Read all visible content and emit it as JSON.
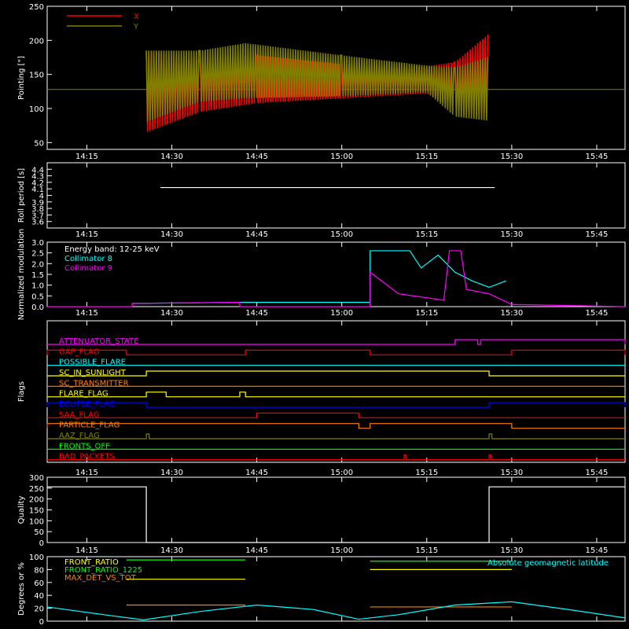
{
  "time_ticks": [
    "14:15",
    "14:30",
    "14:45",
    "15:00",
    "15:15",
    "15:30",
    "15:45"
  ],
  "chart_data": [
    {
      "type": "line",
      "panel": "pointing",
      "ylabel": "Pointing [\"]",
      "ylim": [
        40,
        250
      ],
      "yticks": [
        50,
        100,
        150,
        200,
        250
      ],
      "x_range": [
        "14:08",
        "15:50"
      ],
      "legend": {
        "placement": "top-left"
      },
      "baseline": 128,
      "series": [
        {
          "name": "X",
          "color": "#ff0000",
          "envelope": [
            {
              "t": "14:25.5",
              "min": 65,
              "max": 185
            },
            {
              "t": "14:35",
              "min": 95,
              "max": 172
            },
            {
              "t": "14:45",
              "min": 108,
              "max": 178
            },
            {
              "t": "15:00",
              "min": 115,
              "max": 165
            },
            {
              "t": "15:15",
              "min": 122,
              "max": 162
            },
            {
              "t": "15:20",
              "min": 100,
              "max": 168
            },
            {
              "t": "15:26",
              "min": 88,
              "max": 210
            }
          ]
        },
        {
          "name": "Y",
          "color": "#808000",
          "envelope": [
            {
              "t": "14:25.5",
              "min": 80,
              "max": 185
            },
            {
              "t": "14:35",
              "min": 110,
              "max": 185
            },
            {
              "t": "14:43",
              "min": 115,
              "max": 196
            },
            {
              "t": "15:00",
              "min": 118,
              "max": 178
            },
            {
              "t": "15:15",
              "min": 124,
              "max": 163
            },
            {
              "t": "15:20",
              "min": 88,
              "max": 160
            },
            {
              "t": "15:26",
              "min": 82,
              "max": 176
            }
          ]
        }
      ]
    },
    {
      "type": "line",
      "panel": "roll",
      "ylabel": "Roll period [s]",
      "ylim": [
        3.5,
        4.5
      ],
      "yticks": [
        3.6,
        3.7,
        3.8,
        3.9,
        4.0,
        4.1,
        4.2,
        4.3,
        4.4
      ],
      "series": [
        {
          "name": "",
          "color": "#ffffff",
          "segments": [
            [
              "14:28",
              "15:27",
              4.12
            ]
          ]
        }
      ]
    },
    {
      "type": "line",
      "panel": "modulation",
      "ylabel": "Normalized modulation",
      "ylim": [
        0,
        3.0
      ],
      "yticks": [
        "0.0",
        "0.5",
        "1.0",
        "1.5",
        "2.0",
        "2.5",
        "3.0"
      ],
      "annotation": "Energy band: 12-25 keV",
      "legend": {
        "placement": "top-left"
      },
      "series": [
        {
          "name": "Collimator 8",
          "color": "#00ffff",
          "points": [
            [
              "14:23",
              0.15
            ],
            [
              "14:42",
              0.2
            ],
            [
              "15:05",
              0.2
            ],
            [
              "15:05",
              2.6
            ],
            [
              "15:12",
              2.6
            ],
            [
              "15:14",
              1.8
            ],
            [
              "15:17",
              2.4
            ],
            [
              "15:20",
              1.6
            ],
            [
              "15:23",
              1.2
            ],
            [
              "15:26",
              0.9
            ],
            [
              "15:29",
              1.2
            ]
          ]
        },
        {
          "name": "Collimator 9",
          "color": "#ff00ff",
          "points": [
            [
              "14:08",
              0.0
            ],
            [
              "14:23",
              0.0
            ],
            [
              "14:23",
              0.15
            ],
            [
              "14:42",
              0.2
            ],
            [
              "14:42",
              0.0
            ],
            [
              "15:05",
              0.0
            ],
            [
              "15:05",
              1.6
            ],
            [
              "15:10",
              0.6
            ],
            [
              "15:18",
              0.3
            ],
            [
              "15:19",
              2.6
            ],
            [
              "15:21",
              2.6
            ],
            [
              "15:22",
              0.8
            ],
            [
              "15:26",
              0.6
            ],
            [
              "15:30",
              0.1
            ],
            [
              "15:50",
              0.0
            ]
          ]
        }
      ]
    },
    {
      "type": "line",
      "panel": "flags",
      "ylabel": "Flags",
      "rows": [
        {
          "name": "ATTENUATOR_STATE",
          "color": "#ff00ff",
          "highs": [
            [
              "15:20",
              "15:24"
            ],
            [
              "15:24.5",
              "15:50"
            ]
          ]
        },
        {
          "name": "GAP_FLAG",
          "color": "#ff0000",
          "highs": [
            [
              "14:08",
              "14:22"
            ],
            [
              "14:43",
              "15:05"
            ],
            [
              "15:30",
              "15:50"
            ]
          ]
        },
        {
          "name": "POSSIBLE_FLARE",
          "color": "#00ffff",
          "highs": []
        },
        {
          "name": "SC_IN_SUNLIGHT",
          "color": "#ffff00",
          "highs": [
            [
              "14:25.5",
              "15:26"
            ]
          ]
        },
        {
          "name": "SC_TRANSMITTER",
          "color": "#ff7f00",
          "highs": []
        },
        {
          "name": "FLARE_FLAG",
          "color": "#ffff00",
          "highs": [
            [
              "14:25.5",
              "14:29"
            ],
            [
              "14:42",
              "14:43"
            ]
          ]
        },
        {
          "name": "ECLIPSE_FLAG",
          "color": "#0000ff",
          "highs": [
            [
              "14:08",
              "14:25.5"
            ],
            [
              "15:26",
              "15:50"
            ]
          ]
        },
        {
          "name": "SAA_FLAG",
          "color": "#ff0000",
          "highs": [
            [
              "14:45",
              "15:03"
            ]
          ]
        },
        {
          "name": "PARTICLE_FLAG",
          "color": "#ff7f00",
          "highs": [
            [
              "14:08",
              "15:03"
            ],
            [
              "15:05",
              "15:30"
            ]
          ]
        },
        {
          "name": "AAZ_FLAG",
          "color": "#808000",
          "highs": [
            [
              "14:25.5",
              "14:26"
            ],
            [
              "15:26",
              "15:26.5"
            ]
          ]
        },
        {
          "name": "FRONTS_OFF",
          "color": "#00ff00",
          "highs": []
        },
        {
          "name": "BAD_PACKETS",
          "color": "#ff0000",
          "highs": [
            [
              "15:11",
              "15:11.3"
            ],
            [
              "15:26",
              "15:26.3"
            ]
          ]
        }
      ]
    },
    {
      "type": "line",
      "panel": "quality",
      "ylabel": "Quality",
      "ylim": [
        0,
        300
      ],
      "yticks": [
        0,
        50,
        100,
        150,
        200,
        250,
        300
      ],
      "series": [
        {
          "name": "",
          "color": "#ffffff",
          "points": [
            [
              "14:08",
              256
            ],
            [
              "14:25.5",
              256
            ],
            [
              "14:25.5",
              0
            ],
            [
              "15:26",
              0
            ],
            [
              "15:26",
              256
            ],
            [
              "15:50",
              256
            ]
          ]
        }
      ]
    },
    {
      "type": "line",
      "panel": "ratios",
      "ylabel": "Degrees or %",
      "ylim": [
        0,
        100
      ],
      "yticks": [
        0,
        20,
        40,
        60,
        80,
        100
      ],
      "annotation": "Absolute geomagnetic latitude",
      "legend": {
        "placement": "top-left"
      },
      "series": [
        {
          "name": "FRONT_RATIO",
          "color": "#ffff00",
          "segments": [
            [
              "14:22",
              "14:43",
              65
            ],
            [
              "15:05",
              "15:30",
              80
            ]
          ]
        },
        {
          "name": "FRONT_RATIO_1225",
          "color": "#00ff00",
          "segments": [
            [
              "14:22",
              "14:43",
              95
            ],
            [
              "15:05",
              "15:30",
              93
            ]
          ]
        },
        {
          "name": "MAX_DET_VS_TOT",
          "color": "#ff7f00",
          "segments": [
            [
              "14:22",
              "14:43",
              25
            ],
            [
              "15:05",
              "15:30",
              22
            ]
          ]
        },
        {
          "name": "Absolute geomagnetic latitude",
          "color": "#00ffff",
          "points": [
            [
              "14:08",
              22
            ],
            [
              "14:18",
              10
            ],
            [
              "14:25",
              2
            ],
            [
              "14:35",
              15
            ],
            [
              "14:45",
              25
            ],
            [
              "14:55",
              18
            ],
            [
              "15:03",
              3
            ],
            [
              "15:10",
              10
            ],
            [
              "15:20",
              25
            ],
            [
              "15:30",
              30
            ],
            [
              "15:40",
              18
            ],
            [
              "15:50",
              5
            ]
          ]
        }
      ]
    }
  ]
}
